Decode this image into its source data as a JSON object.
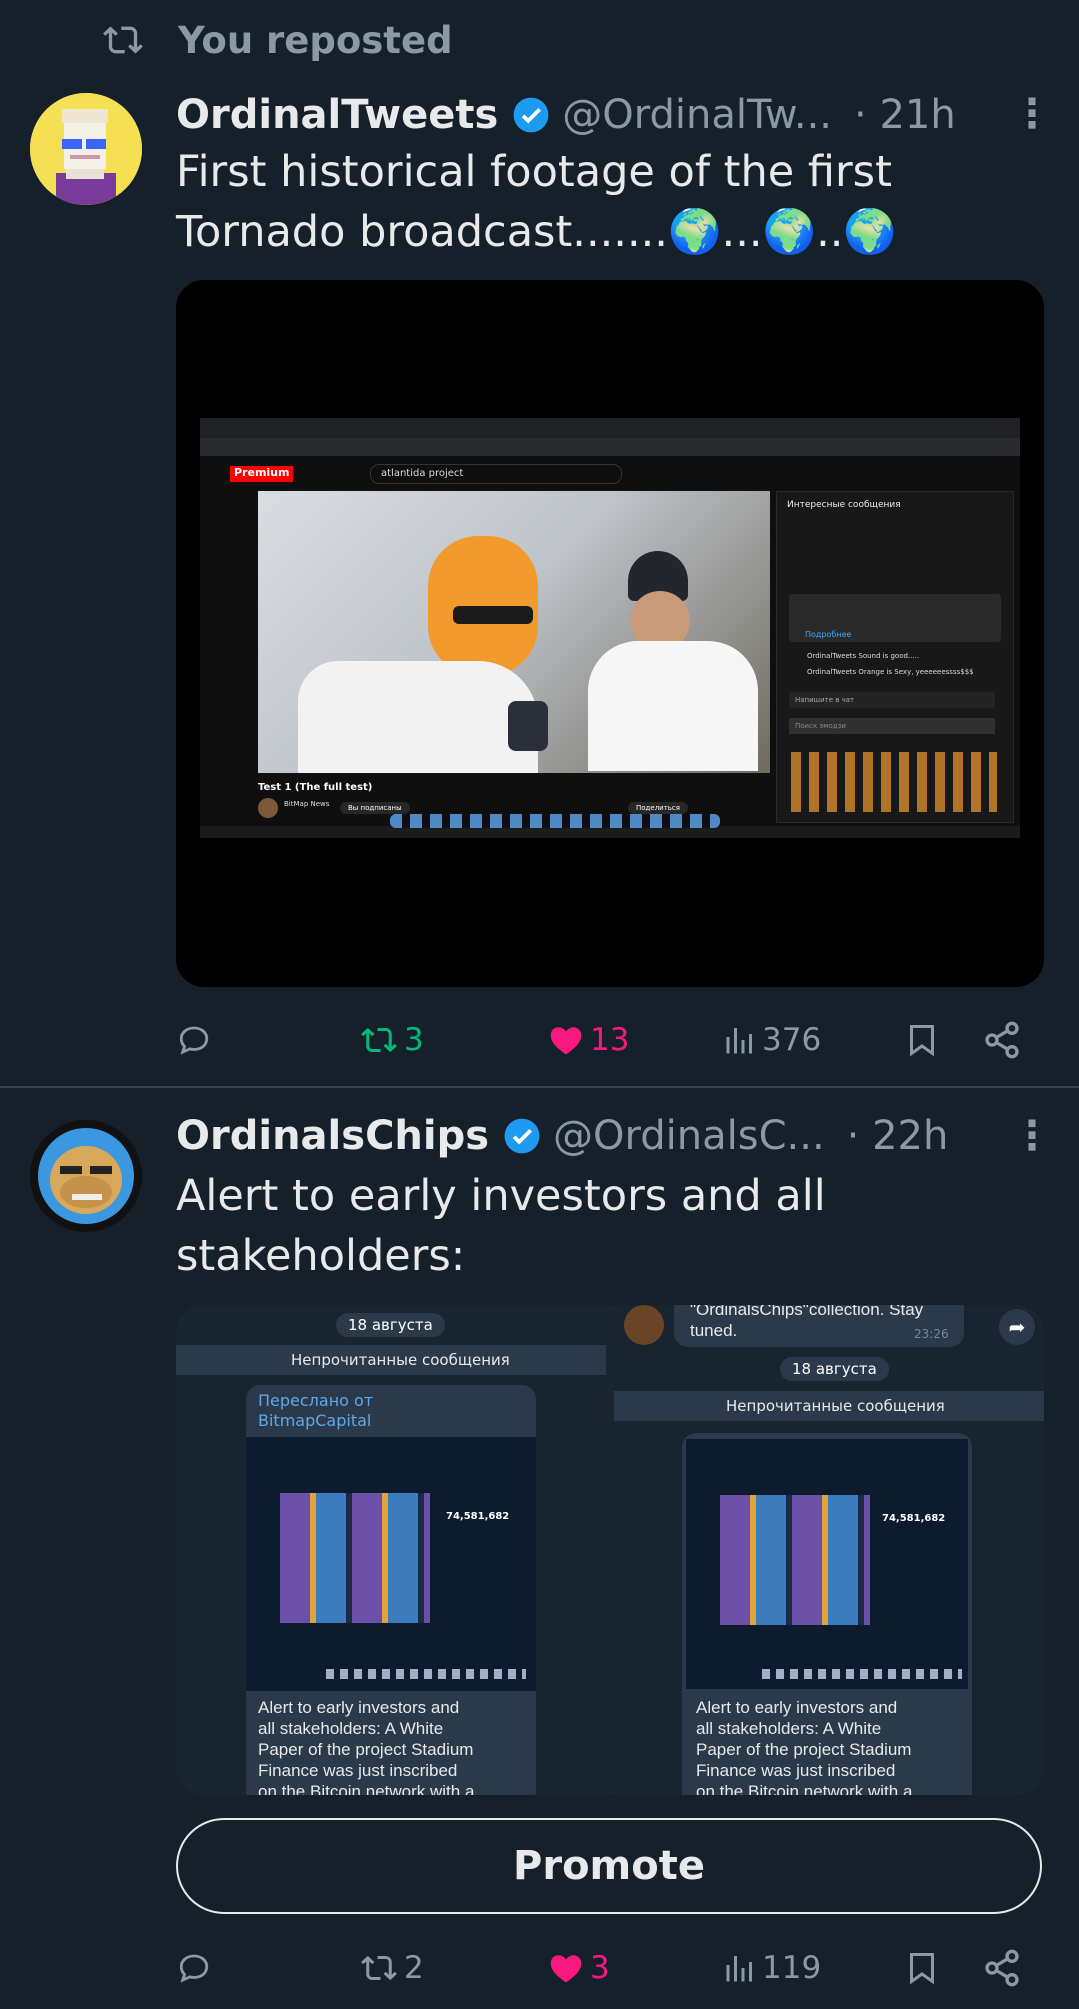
{
  "repost": {
    "label": "You reposted"
  },
  "tweets": [
    {
      "name": "OrdinalTweets",
      "handle": "@OrdinalTw...",
      "time": "· 21h",
      "text_line1": "First historical footage of the first",
      "text_line2": "Tornado broadcast.......🌍...🌍..🌍",
      "media": {
        "search_text": "atlantida project",
        "video_title": "Test 1 (The full test)",
        "channel": "BitMap News",
        "subscribe_label": "Вы подписаны",
        "share_label": "Поделиться",
        "chat_title": "Интересные сообщения",
        "chat_placeholder": "Напишите в чат",
        "chat_msg1": "OrdinalTweets  Sound is good.....",
        "chat_msg2": "OrdinalTweets  Orange is Sexy, yeeeeeessss$$$",
        "chat_link": "Подробнее",
        "emoji_search": "Поиск эмодзи",
        "logo": "Premium"
      },
      "stats": {
        "replies": "",
        "reposts": "3",
        "likes": "13",
        "views": "376"
      }
    },
    {
      "name": "OrdinalsChips",
      "handle": "@OrdinalsC...",
      "time": "· 22h",
      "text_line1": "Alert to early investors and all",
      "text_line2": "stakeholders:",
      "media": {
        "date_label": "18 августа",
        "unread_label": "Непрочитанные сообщения",
        "forwarded_label": "Переслано от",
        "forwarded_from": "BitmapCapital",
        "number": "74,581,682",
        "msg_line1": "Alert to early investors and",
        "msg_line2": "all stakeholders: A White",
        "msg_line3": "Paper of the project Stadium",
        "msg_line4": "Finance was just inscribed",
        "msg_line5": "on the Bitcoin network with a",
        "prev_msg_line1": "\"OrdinalsChips\"collection. Stay",
        "prev_msg_line2": "tuned.",
        "prev_time": "23:26"
      },
      "promote_label": "Promote",
      "stats": {
        "replies": "",
        "reposts": "2",
        "likes": "3",
        "views": "119"
      }
    }
  ],
  "colors": {
    "background": "#15202b",
    "muted": "#8b98a5",
    "repost_active": "#00ba7c",
    "like_active": "#f91880",
    "verified": "#1d9bf0"
  }
}
